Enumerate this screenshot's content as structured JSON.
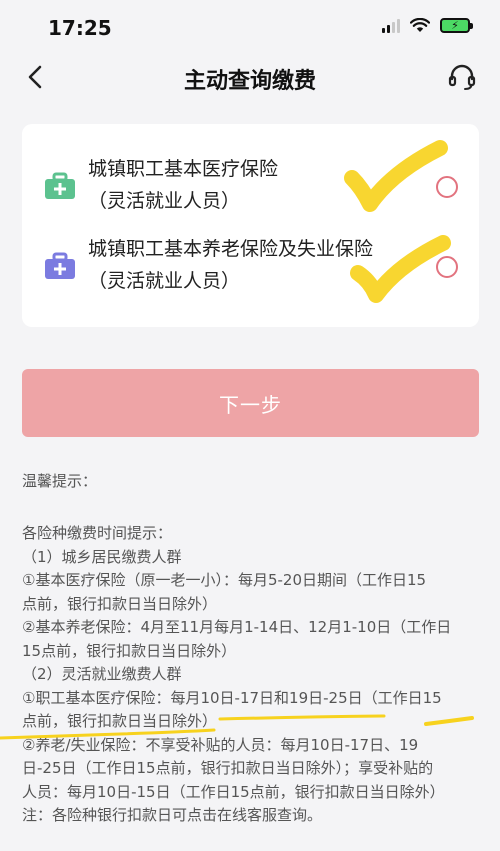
{
  "status_bar": {
    "time": "17:25",
    "icons": [
      "signal-icon",
      "wifi-icon",
      "battery-charging-icon"
    ]
  },
  "header": {
    "title": "主动查询缴费",
    "back_icon": "chevron-left-icon",
    "support_icon": "headset-icon"
  },
  "options": [
    {
      "title": "城镇职工基本医疗保险",
      "subtitle": "（灵活就业人员）",
      "icon": "medical-kit-icon",
      "icon_color": "#5cc28f",
      "selected": false
    },
    {
      "title": "城镇职工基本养老保险及失业保险",
      "subtitle": "（灵活就业人员）",
      "icon": "medical-kit-icon",
      "icon_color": "#7b7be0",
      "selected": false
    }
  ],
  "next_button": {
    "label": "下一步",
    "color": "#eea4a6"
  },
  "tips": {
    "heading": "温馨提示：",
    "lines": [
      "各险种缴费时间提示：",
      "（1）城乡居民缴费人群",
      "①基本医疗保险（原一老一小）：每月5-20日期间（工作日15",
      "点前，银行扣款日当日除外）",
      "②基本养老保险：4月至11月每月1-14日、12月1-10日（工作日",
      "15点前，银行扣款日当日除外）",
      "（2）灵活就业缴费人群",
      "①职工基本医疗保险：每月10日-17日和19日-25日（工作日15",
      "点前，银行扣款日当日除外）",
      "②养老/失业保险：不享受补贴的人员：每月10日-17日、19",
      "日-25日（工作日15点前，银行扣款日当日除外）；享受补贴的",
      "人员：每月10日-15日（工作日15点前，银行扣款日当日除外）",
      "注：各险种银行扣款日可点击在线客服查询。"
    ]
  },
  "colors": {
    "accent": "#e2737f",
    "annotation_yellow": "#f7d21e",
    "background": "#f4f4f6"
  }
}
